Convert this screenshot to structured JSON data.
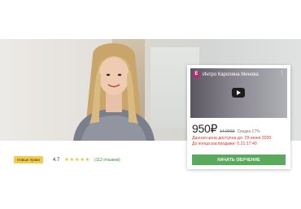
{
  "video": {
    "avatar_letter": "E",
    "title": "Интро Каролина Минова"
  },
  "pricing": {
    "price": "950₽",
    "old_price": "14 000₽",
    "discount": "Скидка 17%",
    "valid_until": "Данная цена доступна до: 29 июня 2020",
    "countdown": "До конца распродажи: 0.21:17:40"
  },
  "cta_label": "НАЧАТЬ ОБУЧЕНИЕ",
  "meta": {
    "badge": "Новые Уроки",
    "rating": "4.7",
    "stars_filled": 5,
    "reviews": "(112 отзывов)"
  },
  "colors": {
    "accent_green": "#5aaa5e",
    "deadline_red": "#d9352e",
    "badge_yellow": "#f3ca4c",
    "star": "#f1b62a",
    "video_avatar": "#c02579"
  },
  "icons": {
    "video_menu": "more-vertical-icon",
    "video_play": "play-icon",
    "rating": "star-icon"
  }
}
